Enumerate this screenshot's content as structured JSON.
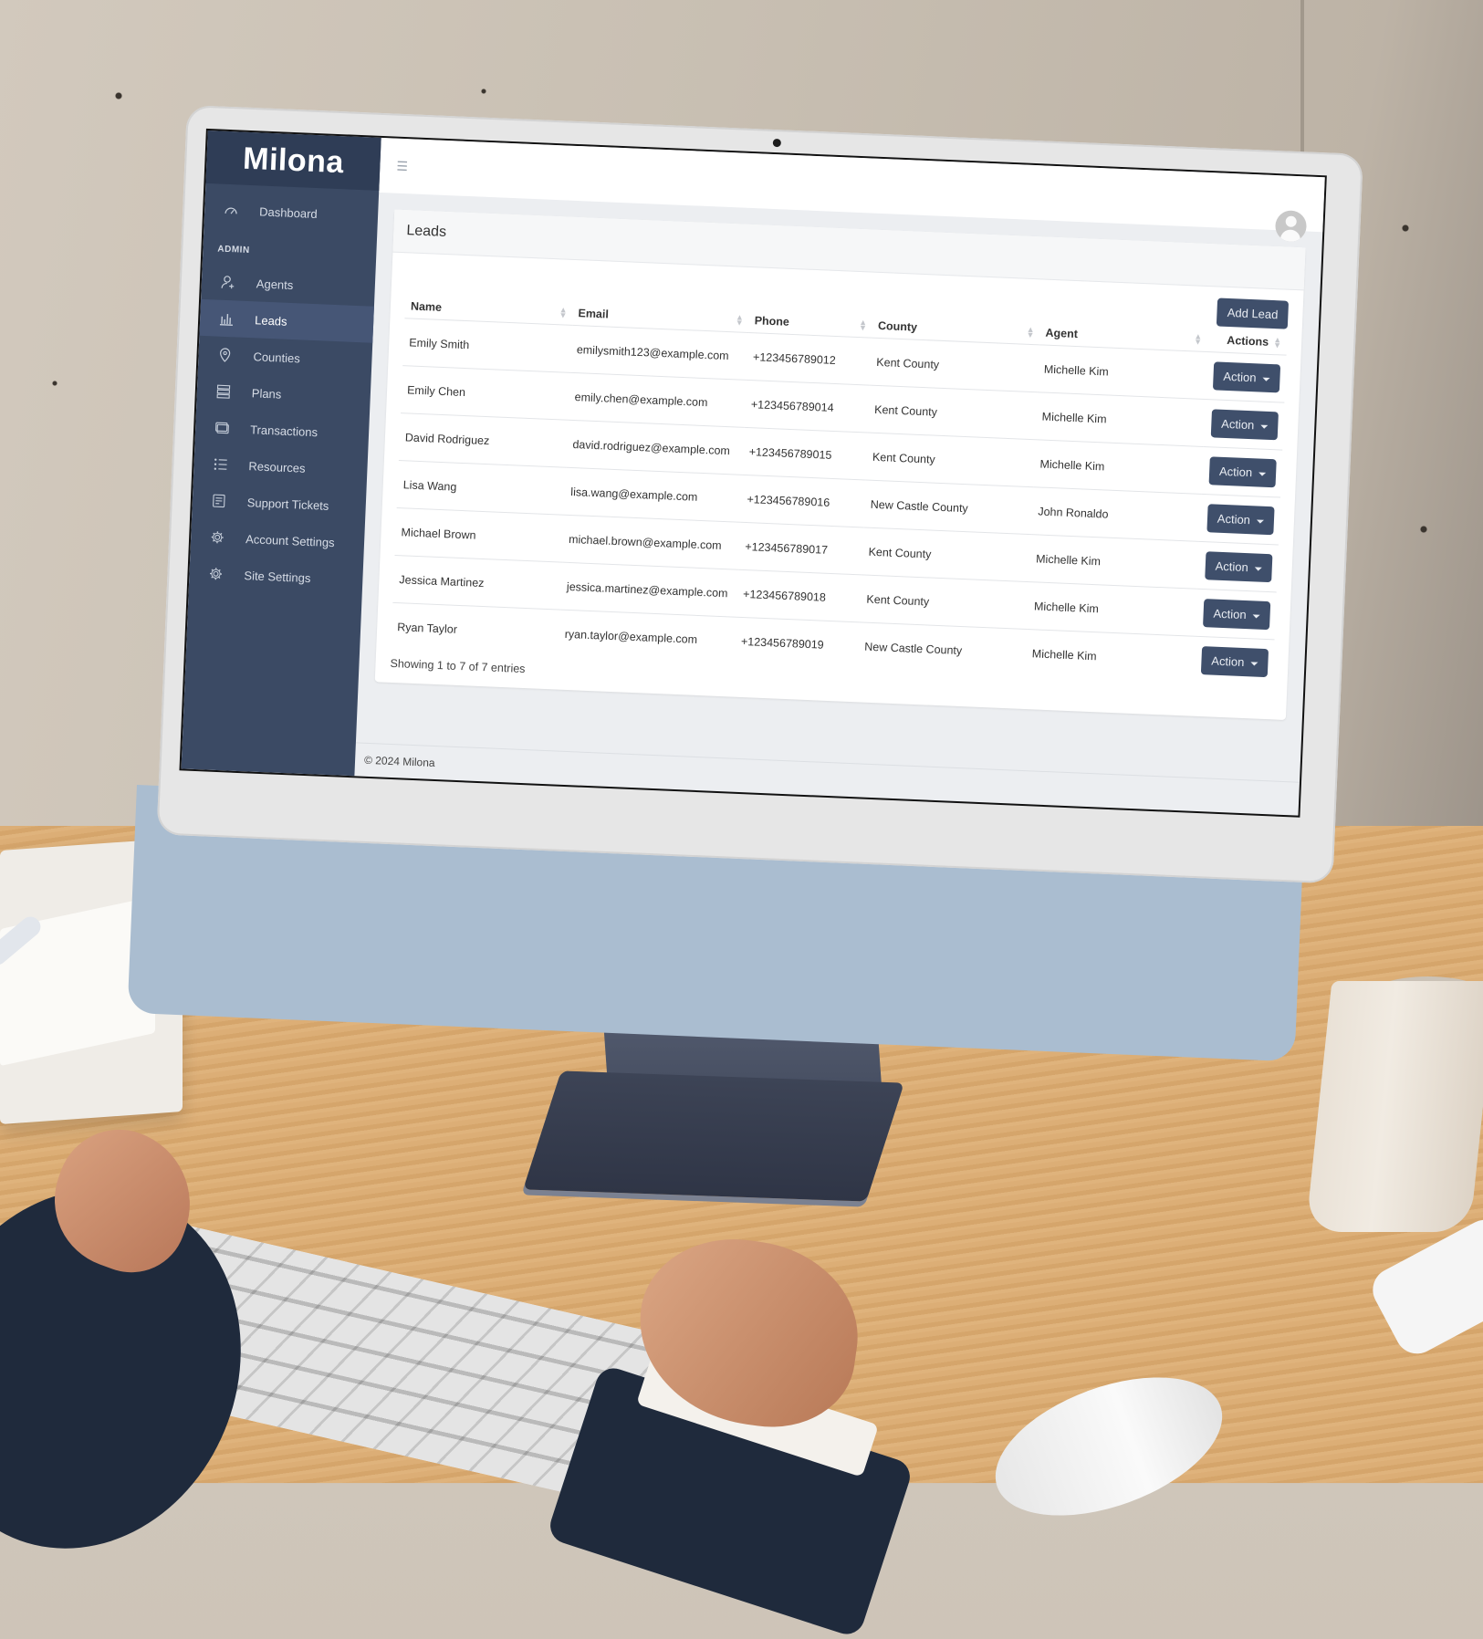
{
  "app": {
    "brand": "Milona",
    "footer": "© 2024 Milona"
  },
  "sidebar": {
    "top_item": {
      "label": "Dashboard",
      "icon": "dashboard-icon"
    },
    "section_label": "ADMIN",
    "items": [
      {
        "label": "Agents",
        "icon": "user-plus-icon",
        "active": false
      },
      {
        "label": "Leads",
        "icon": "bar-chart-icon",
        "active": true
      },
      {
        "label": "Counties",
        "icon": "map-pin-icon",
        "active": false
      },
      {
        "label": "Plans",
        "icon": "list-icon",
        "active": false
      },
      {
        "label": "Transactions",
        "icon": "receipt-icon",
        "active": false
      },
      {
        "label": "Resources",
        "icon": "checklist-icon",
        "active": false
      },
      {
        "label": "Support Tickets",
        "icon": "ticket-icon",
        "active": false
      },
      {
        "label": "Account Settings",
        "icon": "gear-icon",
        "active": false
      },
      {
        "label": "Site Settings",
        "icon": "gear-icon",
        "active": false
      }
    ]
  },
  "topbar": {
    "menu_icon": "hamburger-icon",
    "avatar_icon": "user-avatar-icon"
  },
  "leads": {
    "title": "Leads",
    "add_button": "Add Lead",
    "columns": [
      "Name",
      "Email",
      "Phone",
      "County",
      "Agent",
      "Actions"
    ],
    "rows": [
      {
        "name": "Emily Smith",
        "email": "emilysmith123@example.com",
        "phone": "+123456789012",
        "county": "Kent County",
        "agent": "Michelle Kim",
        "action": "Action"
      },
      {
        "name": "Emily Chen",
        "email": "emily.chen@example.com",
        "phone": "+123456789014",
        "county": "Kent County",
        "agent": "Michelle Kim",
        "action": "Action"
      },
      {
        "name": "David Rodriguez",
        "email": "david.rodriguez@example.com",
        "phone": "+123456789015",
        "county": "Kent County",
        "agent": "Michelle Kim",
        "action": "Action"
      },
      {
        "name": "Lisa Wang",
        "email": "lisa.wang@example.com",
        "phone": "+123456789016",
        "county": "New Castle County",
        "agent": "John Ronaldo",
        "action": "Action"
      },
      {
        "name": "Michael Brown",
        "email": "michael.brown@example.com",
        "phone": "+123456789017",
        "county": "Kent County",
        "agent": "Michelle Kim",
        "action": "Action"
      },
      {
        "name": "Jessica Martinez",
        "email": "jessica.martinez@example.com",
        "phone": "+123456789018",
        "county": "Kent County",
        "agent": "Michelle Kim",
        "action": "Action"
      },
      {
        "name": "Ryan Taylor",
        "email": "ryan.taylor@example.com",
        "phone": "+123456789019",
        "county": "New Castle County",
        "agent": "Michelle Kim",
        "action": "Action"
      }
    ],
    "entries_info": "Showing 1 to 7 of 7 entries"
  },
  "colors": {
    "sidebar": "#3b4a64",
    "sidebar_logo": "#2f3d56",
    "button": "#3f4f6b",
    "content_bg": "#eceef1"
  }
}
